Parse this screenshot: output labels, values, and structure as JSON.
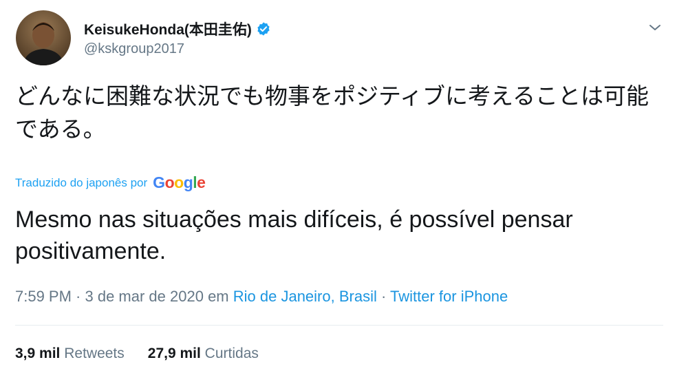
{
  "author": {
    "display_name": "KeisukeHonda(本田圭佑)",
    "handle": "@kskgroup2017",
    "verified": true
  },
  "tweet": {
    "text": "どんなに困難な状況でも物事をポジティブに考えることは可能である。",
    "translation_label": "Traduzido do japonês por",
    "translation_provider": [
      "G",
      "o",
      "o",
      "g",
      "l",
      "e"
    ],
    "translated_text": "Mesmo nas situações mais difíceis, é possível pensar positivamente."
  },
  "meta": {
    "timestamp": "7:59 PM · 3 de mar de 2020",
    "location_prefix": "em",
    "location": "Rio de Janeiro, Brasil",
    "separator": "·",
    "source": "Twitter for iPhone"
  },
  "stats": {
    "retweets_count": "3,9 mil",
    "retweets_label": "Retweets",
    "likes_count": "27,9 mil",
    "likes_label": "Curtidas"
  },
  "icons": {
    "verified": "verified-badge-icon",
    "menu": "chevron-down-icon"
  },
  "colors": {
    "link": "#1b95e0",
    "verified": "#1da1f2",
    "secondary_text": "#657786",
    "google_blue": "#4285f4",
    "google_red": "#ea4335",
    "google_yellow": "#fbbc05",
    "google_green": "#34a853"
  }
}
